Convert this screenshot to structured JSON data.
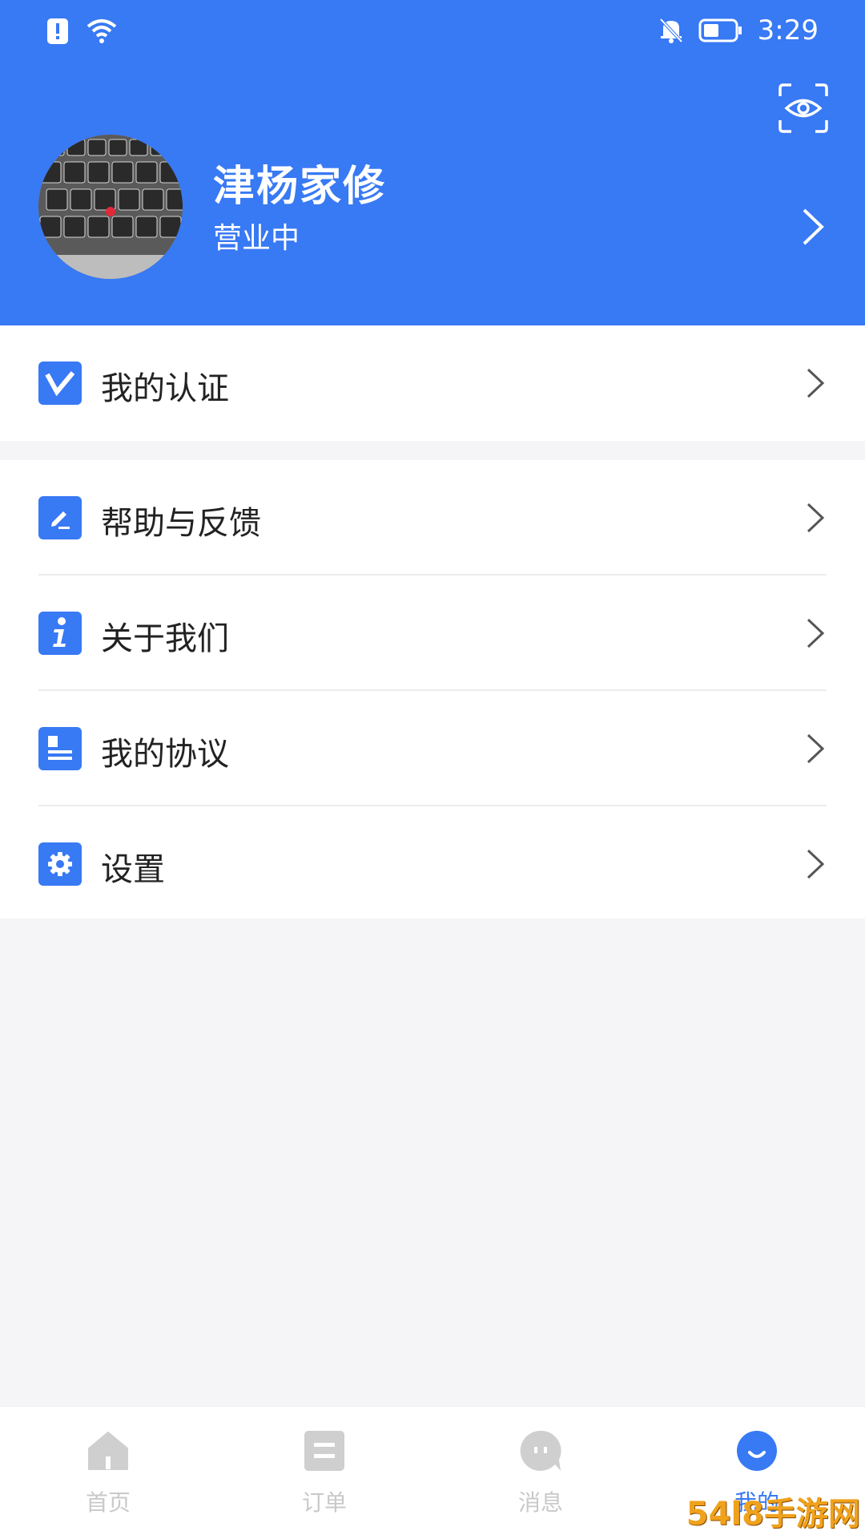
{
  "status_bar": {
    "time": "3:29",
    "icons": [
      "alert-icon",
      "wifi-icon",
      "bell-off-icon",
      "battery-icon"
    ]
  },
  "header": {
    "shop_name": "津杨家修",
    "shop_status": "营业中",
    "scan_icon": "eye-scan-icon"
  },
  "menu_group_1": [
    {
      "label": "我的认证",
      "icon": "verify-icon"
    }
  ],
  "menu_group_2": [
    {
      "label": "帮助与反馈",
      "icon": "edit-icon"
    },
    {
      "label": "关于我们",
      "icon": "info-icon"
    },
    {
      "label": "我的协议",
      "icon": "document-icon"
    },
    {
      "label": "设置",
      "icon": "gear-icon"
    }
  ],
  "tabbar": {
    "tabs": [
      {
        "label": "首页",
        "icon": "home-icon",
        "active": false
      },
      {
        "label": "订单",
        "icon": "order-icon",
        "active": false
      },
      {
        "label": "消息",
        "icon": "message-icon",
        "active": false
      },
      {
        "label": "我的",
        "icon": "profile-icon",
        "active": true
      }
    ]
  },
  "watermark": "54l8手游网",
  "colors": {
    "primary": "#3879f4",
    "background": "#f5f5f7",
    "inactive_tab": "#c9c9c9",
    "text": "#222222"
  }
}
